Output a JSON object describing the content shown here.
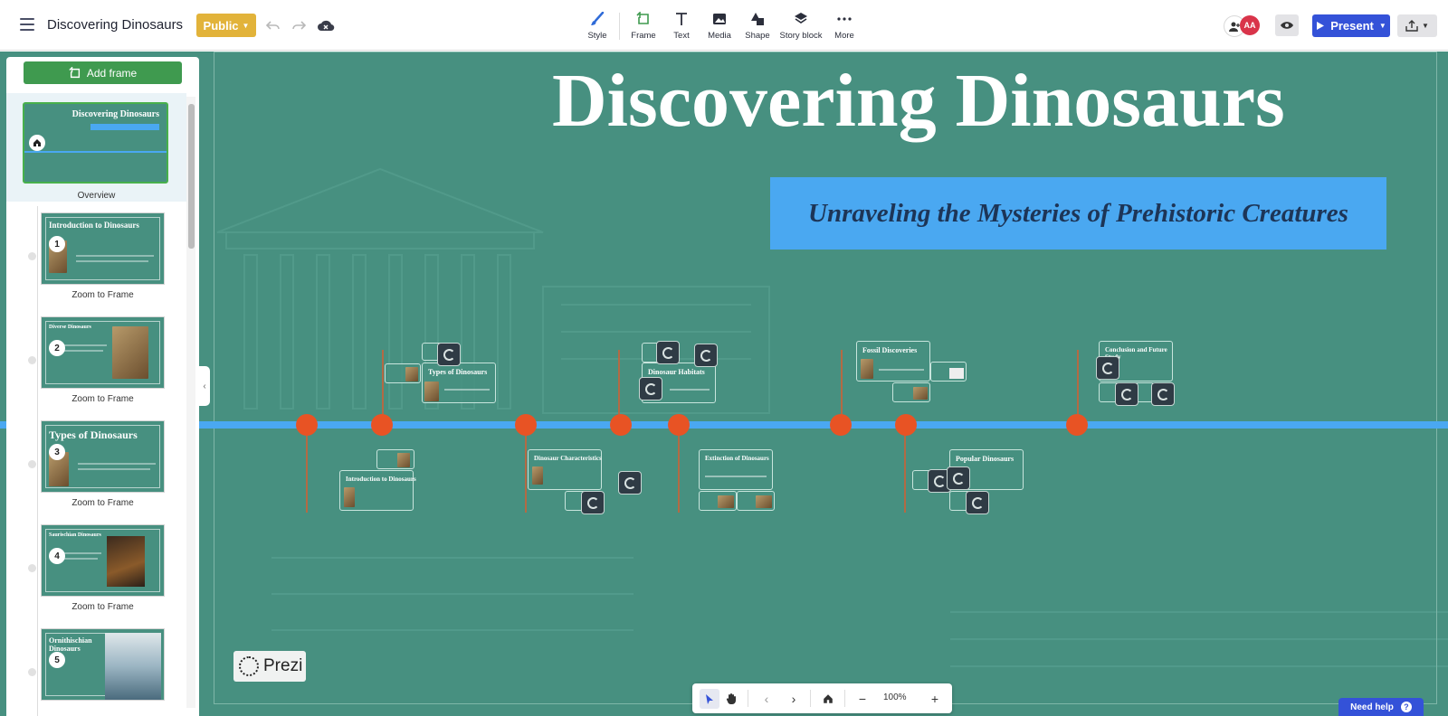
{
  "topbar": {
    "doc_title": "Discovering Dinosaurs",
    "public_label": "Public",
    "tools": [
      {
        "label": "Style",
        "icon": "brush-icon"
      },
      {
        "label": "Frame",
        "icon": "frame-icon"
      },
      {
        "label": "Text",
        "icon": "text-icon"
      },
      {
        "label": "Media",
        "icon": "image-icon"
      },
      {
        "label": "Shape",
        "icon": "shape-icon"
      },
      {
        "label": "Story block",
        "icon": "layers-icon"
      },
      {
        "label": "More",
        "icon": "more-icon"
      }
    ],
    "avatar_initials": "AA",
    "present_label": "Present"
  },
  "canvas": {
    "title": "Discovering Dinosaurs",
    "subtitle": "Unraveling the Mysteries of Prehistoric Creatures",
    "frames": {
      "types": "Types of Dinosaurs",
      "habitats": "Dinosaur Habitats",
      "fossil": "Fossil Discoveries",
      "conclusion": "Conclusion and Future Study",
      "intro": "Introduction to Dinosaurs",
      "characteristics": "Dinosaur Characteristics",
      "extinction": "Extinction of Dinosaurs",
      "popular": "Popular Dinosaurs"
    },
    "logo_text": "Prezi"
  },
  "panel": {
    "add_frame_label": "Add frame",
    "overview": {
      "thumb_title": "Discovering Dinosaurs",
      "label": "Overview"
    },
    "steps": [
      {
        "num": "1",
        "title": "Introduction to Dinosaurs",
        "label": "Zoom to Frame"
      },
      {
        "num": "2",
        "title": "Diverse Dinosaurs",
        "label": "Zoom to Frame"
      },
      {
        "num": "3",
        "title": "Types of Dinosaurs",
        "label": "Zoom to Frame"
      },
      {
        "num": "4",
        "title": "Saurischian Dinosaurs",
        "label": "Zoom to Frame"
      },
      {
        "num": "5",
        "title": "Ornithischian Dinosaurs",
        "label": "Zoom to Frame"
      }
    ]
  },
  "bottombar": {
    "zoom": "100%"
  },
  "help_label": "Need help",
  "colors": {
    "canvas": "#479080",
    "accent_blue": "#3452d8",
    "timeline_blue": "#4aa8f1",
    "timeline_dot": "#e85324",
    "public_yellow": "#e2b33a",
    "add_frame_green": "#3f9a4f"
  }
}
